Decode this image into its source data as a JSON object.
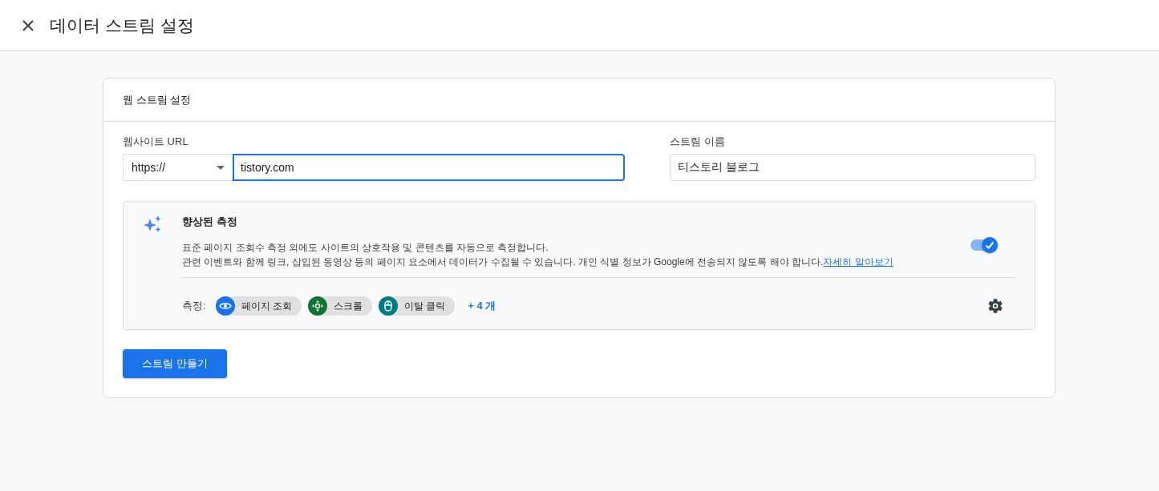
{
  "window": {
    "title": "데이터 스트림 설정"
  },
  "card": {
    "title": "웹 스트림 설정",
    "url": {
      "label": "웹사이트 URL",
      "protocol": "https://",
      "value": "tistory.com",
      "focused": true
    },
    "stream_name": {
      "label": "스트림 이름",
      "value": "티스토리 블로그"
    },
    "enhanced": {
      "title": "향상된 측정",
      "on": true,
      "description": [
        "표준 페이지 조회수 측정 외에도 사이트의 상호작용 및 콘텐츠를 자동으로 측정합니다.",
        "관련 이벤트와 함께 링크, 삽입된 동영상 등의 페이지 요소에서 데이터가 수집될 수 있습니다. 개인 식별 정보가 Google에 전송되지 않도록 해야 합니다."
      ],
      "link": "자세히 알아보기",
      "measures_label": "측정:",
      "chips": [
        {
          "kind": "eye",
          "label": "페이지 조회",
          "color": "#1a73e8"
        },
        {
          "kind": "scroll",
          "label": "스크롤",
          "color": "#137333"
        },
        {
          "kind": "mouse",
          "label": "이탈 클릭",
          "color": "#007b83"
        }
      ],
      "more": "+ 4 개"
    },
    "button": "스트림 만들기"
  }
}
